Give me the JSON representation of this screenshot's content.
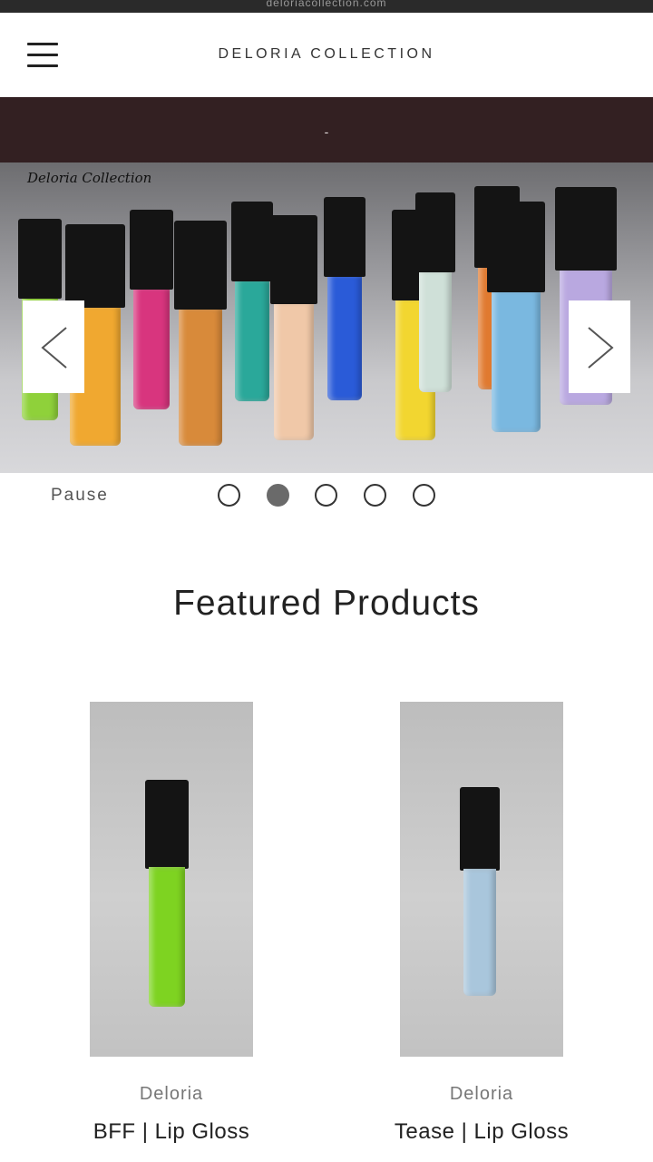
{
  "browser": {
    "url": "deloriacollection.com"
  },
  "header": {
    "brand": "DELORIA COLLECTION",
    "menu_icon": "hamburger-icon"
  },
  "announcement": {
    "text": "-"
  },
  "slideshow": {
    "caption": "Deloria Collection",
    "prev_icon": "chevron-left-icon",
    "next_icon": "chevron-right-icon",
    "pause_label": "Pause",
    "slide_count": 5,
    "active_slide": 2,
    "gloss_colors": [
      "#8fd13a",
      "#f0a830",
      "#d8357e",
      "#d88a3a",
      "#2aa89a",
      "#f0c8a8",
      "#2a5bd8",
      "#f2d630",
      "#cfe0d8",
      "#e07a30",
      "#7ab8e0",
      "#b9a8e0"
    ]
  },
  "featured": {
    "title": "Featured Products",
    "products": [
      {
        "vendor": "Deloria",
        "title": "BFF | Lip Gloss",
        "color": "#7ed321"
      },
      {
        "vendor": "Deloria",
        "title": "Tease | Lip Gloss",
        "color": "#a9c6dc"
      }
    ]
  },
  "colors": {
    "announcement_bg": "#332022",
    "header_bg": "#ffffff",
    "dot_active": "#6a6a6a"
  }
}
